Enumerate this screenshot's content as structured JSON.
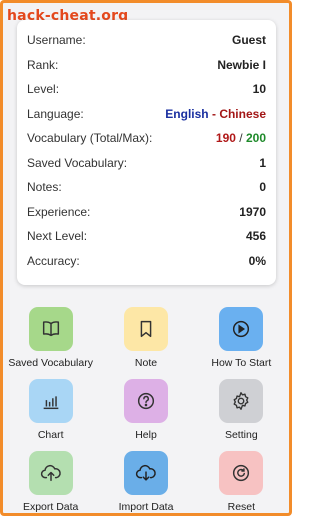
{
  "watermark": "hack-cheat.org",
  "stats": {
    "username_label": "Username:",
    "username_value": "Guest",
    "rank_label": "Rank:",
    "rank_value": "Newbie I",
    "level_label": "Level:",
    "level_value": "10",
    "language_label": "Language:",
    "language_source": "English",
    "language_sep": " - ",
    "language_target": "Chinese",
    "vocab_label": "Vocabulary (Total/Max):",
    "vocab_current": "190",
    "vocab_sep": " / ",
    "vocab_max": "200",
    "saved_label": "Saved Vocabulary:",
    "saved_value": "1",
    "notes_label": "Notes:",
    "notes_value": "0",
    "exp_label": "Experience:",
    "exp_value": "1970",
    "next_label": "Next Level:",
    "next_value": "456",
    "acc_label": "Accuracy:",
    "acc_value": "0%"
  },
  "menu": [
    {
      "label": "Saved Vocabulary",
      "icon": "book-icon",
      "color": "#a6d88a"
    },
    {
      "label": "Note",
      "icon": "bookmark-icon",
      "color": "#fde7a6"
    },
    {
      "label": "How To Start",
      "icon": "play-icon",
      "color": "#6ab0f0"
    },
    {
      "label": "Chart",
      "icon": "bar-chart-icon",
      "color": "#a9d6f5"
    },
    {
      "label": "Help",
      "icon": "help-icon",
      "color": "#ddb0e6"
    },
    {
      "label": "Setting",
      "icon": "gear-icon",
      "color": "#cfd0d4"
    },
    {
      "label": "Export Data",
      "icon": "cloud-upload-icon",
      "color": "#b4dfb0"
    },
    {
      "label": "Import Data",
      "icon": "cloud-download-icon",
      "color": "#6aaee8"
    },
    {
      "label": "Reset",
      "icon": "reset-icon",
      "color": "#f7c2c2"
    }
  ]
}
